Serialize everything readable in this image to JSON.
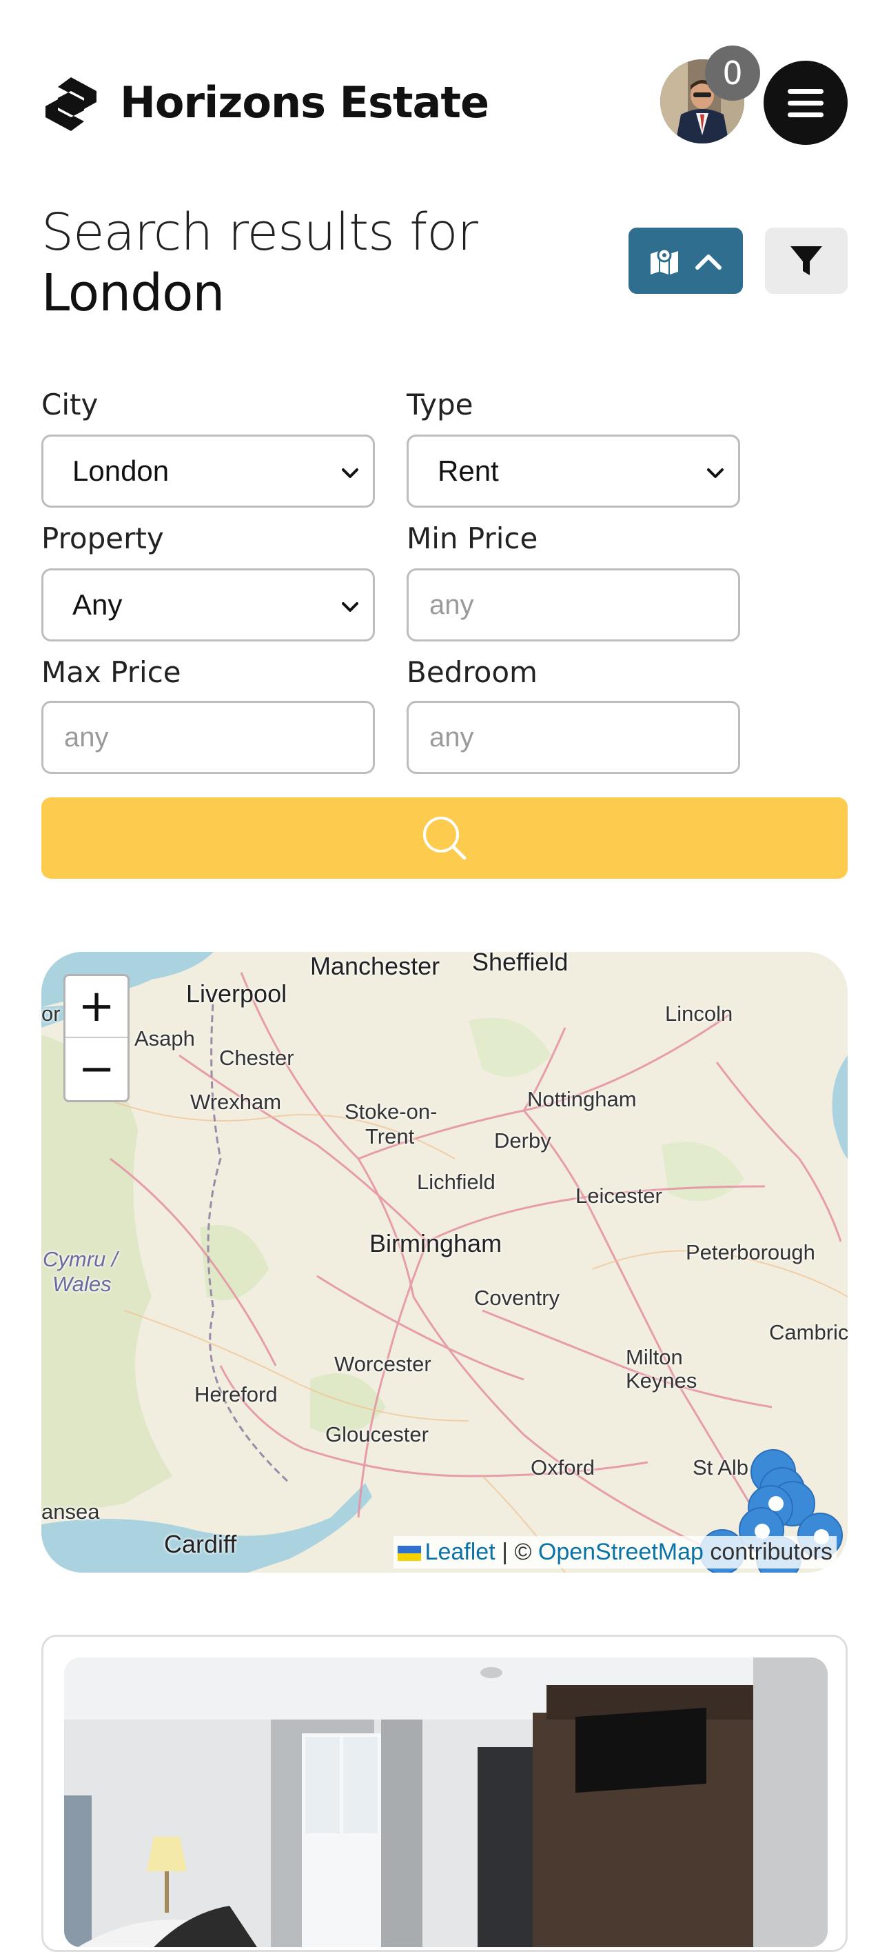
{
  "header": {
    "brand": "Horizons Estate",
    "notification_count": "0"
  },
  "search": {
    "title_prefix": "Search results for",
    "title_city": "London"
  },
  "colors": {
    "accent": "#2f6e8e",
    "search_button": "#fdcb4e",
    "map_pin": "#3a8ad8"
  },
  "filters": {
    "city": {
      "label": "City",
      "value": "London"
    },
    "type": {
      "label": "Type",
      "value": "Rent"
    },
    "property": {
      "label": "Property",
      "value": "Any"
    },
    "min_price": {
      "label": "Min Price",
      "placeholder": "any"
    },
    "max_price": {
      "label": "Max Price",
      "placeholder": "any"
    },
    "bedroom": {
      "label": "Bedroom",
      "placeholder": "any"
    }
  },
  "map": {
    "zoom_in": "+",
    "zoom_out": "−",
    "towns": {
      "liverpool": "Liverpool",
      "manchester": "Manchester",
      "sheffield": "Sheffield",
      "lincoln": "Lincoln",
      "asaph": "Asaph",
      "or": "or",
      "chester": "Chester",
      "wrexham": "Wrexham",
      "stoke1": "Stoke-on-",
      "stoke2": "Trent",
      "nottingham": "Nottingham",
      "derby": "Derby",
      "lichfield": "Lichfield",
      "leicester": "Leicester",
      "cymru": "Cymru /",
      "wales": "Wales",
      "birmingham": "Birmingham",
      "peterborough": "Peterborough",
      "coventry": "Coventry",
      "cambridge": "Cambric",
      "milton": "Milton",
      "keynes": "Keynes",
      "worcester": "Worcester",
      "hereford": "Hereford",
      "gloucester": "Gloucester",
      "oxford": "Oxford",
      "stalbans": "St Alb",
      "swansea": "ansea",
      "cardiff": "Cardiff"
    },
    "attribution": {
      "leaflet": "Leaflet",
      "sep": "| ©",
      "osm": "OpenStreetMap",
      "contrib": "contributors"
    }
  }
}
